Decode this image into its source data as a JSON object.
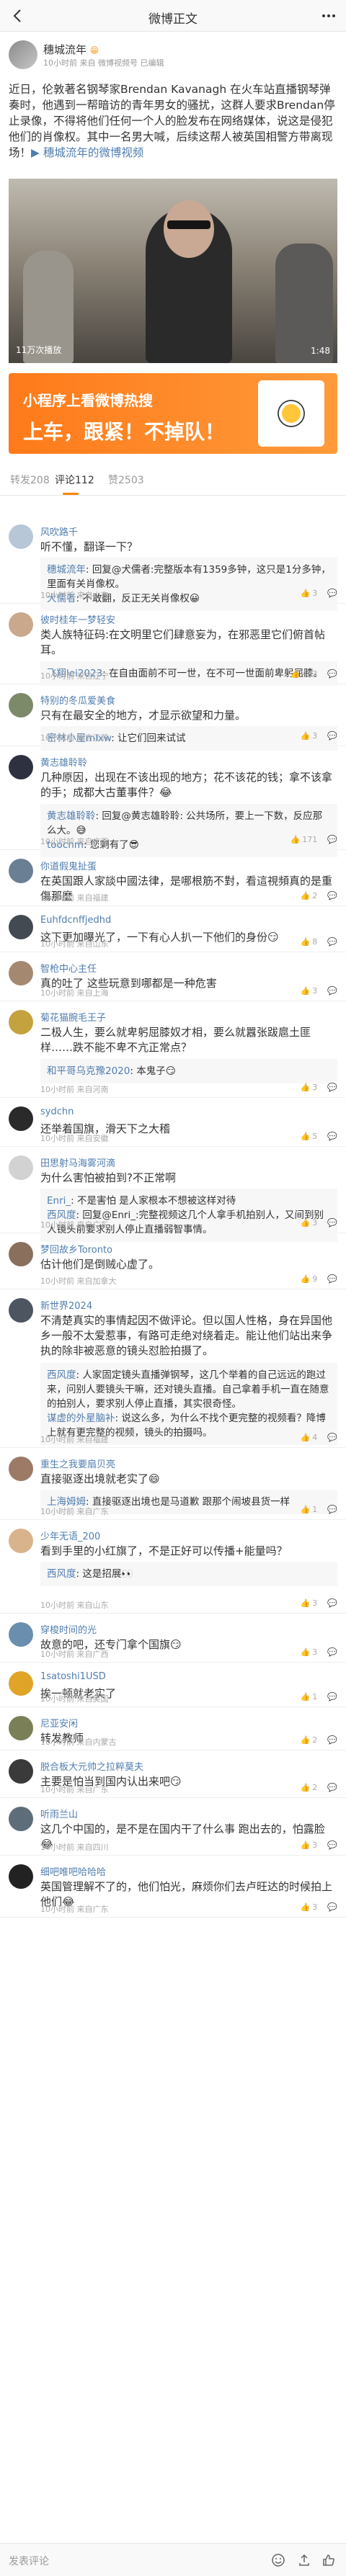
{
  "header": {
    "title": "微博正文"
  },
  "post": {
    "author": "穗城流年",
    "badge": "😁",
    "meta": "10小时前 来自 微博视频号 已编辑",
    "text": "近日，伦敦著名钢琴家Brendan Kavanagh 在火车站直播钢琴弹奏时，他遇到一帮暗访的青年男女的骚扰，这群人要求Brendan停止录像，不得将他们任何一个人的脸发布在网络媒体，说这是侵犯他们的肖像权。其中一名男大喊，后续这帮人被英国相警方带离现场！",
    "link_text": "穗城流年的微博视频",
    "video_count": "11万次播放",
    "video_duration": "1:48"
  },
  "ad": {
    "line1": "小程序上看微博热搜",
    "line2": "上车，跟紧！不掉队！"
  },
  "tabs": {
    "repost": "转发208",
    "comments": "评论112",
    "likes": "赞2503"
  },
  "comments": [
    {
      "name": "风吹路千",
      "text": "听不懂，翻译一下？",
      "replies": [
        {
          "name": "穗城流年",
          "text": "回复@犬儒者:完整版本有1359多钟，这只是1分多钟，里面有关肖像权。"
        },
        {
          "name": "犬儒者",
          "text": "不敢翻，反正无关肖像权😀"
        }
      ],
      "more": "",
      "meta": "10小时前 来自山东",
      "likes": "3",
      "avatar_color": "#b7c7d8"
    },
    {
      "name": "彼时桂年一梦轻安",
      "text": "类人族特征码:在文明里它们肆意妄为，在邪恶里它们俯首帖耳。",
      "replies": [
        {
          "name": "飞翔lei2023",
          "text": "在自由面前不可一世，在不可一世面前卑躬屈膝。"
        }
      ],
      "more": "",
      "meta": "10小时前 来自辽宁",
      "likes": "433",
      "avatar_color": "#caa88c"
    },
    {
      "name": "特别的冬瓜爱美食",
      "text": "只有在最安全的地方，才显示欲望和力量。",
      "replies": [
        {
          "name": "密林小屋mlxw",
          "text": "让它们回来试试"
        }
      ],
      "more": "",
      "meta": "10小时前 来自江苏",
      "likes": "3",
      "avatar_color": "#7c8a6a"
    },
    {
      "name": "黄志雄聆聆",
      "text": "几种原因，出现在不该出现的地方；花不该花的钱；拿不该拿的手；成都大古董事件？😂",
      "replies": [
        {
          "name": "黄志雄聆聆",
          "text": "回复@黄志雄聆聆: 公共场所，要上一下数，反应那么大。😅"
        },
        {
          "name": "toocnm",
          "text": "您剩有了😎"
        }
      ],
      "more": "",
      "meta": "10小时前 来自广西",
      "likes": "171",
      "avatar_color": "#2e3140"
    },
    {
      "name": "你道假鬼扯蛋",
      "text": "在英国跟人家談中國法律，是哪根筋不對，看這視頻真的是重傷那麼",
      "replies": [],
      "more": "",
      "meta": "10小时前 来自福建",
      "likes": "2",
      "avatar_color": "#6b7f94"
    },
    {
      "name": "Euhfdcnffjedhd",
      "text": "这下更加曝光了，一下有心人扒一下他们的身份😏",
      "replies": [],
      "more": "",
      "meta": "10小时前 来自山东",
      "likes": "8",
      "avatar_color": "#444a52"
    },
    {
      "name": "智枪中心主任",
      "text": "真的吐了 这些玩意到哪都是一种危害",
      "replies": [],
      "more": "",
      "meta": "10小时前 来自上海",
      "likes": "3",
      "avatar_color": "#a58870"
    },
    {
      "name": "菊花猫腕毛王子",
      "text": "二极人生，要么就卑躬屈膝奴才相，要么就囂张跋扈土匪样……跌不能不卑不亢正常点？",
      "replies": [
        {
          "name": "和平哥乌克豫2020",
          "text": "本鬼子😏"
        }
      ],
      "more": "",
      "meta": "10小时前 来自河南",
      "likes": "3",
      "avatar_color": "#c4a23e"
    },
    {
      "name": "sydchn",
      "text": "还举着国旗，滑天下之大稽",
      "replies": [],
      "more": "",
      "meta": "10小时前 来自安徽",
      "likes": "5",
      "avatar_color": "#2a2a2a"
    },
    {
      "name": "田思射马海雾河滴",
      "text": "为什么害怕被拍到?不正常啊",
      "replies": [
        {
          "name": "Enri_",
          "text": "不是害怕 是人家根本不想被这样对待"
        },
        {
          "name": "西风度",
          "text": "回复@Enri_:完整视频这几个人拿手机拍别人，又间到别人镜头前要求别人停止直播弱智事情。"
        }
      ],
      "more": "",
      "meta": "10小时前 来自广东",
      "likes": "3",
      "avatar_color": "#d2d2d2"
    },
    {
      "name": "梦回故乡Toronto",
      "text": "估计他们是倒贼心虚了。",
      "replies": [],
      "more": "",
      "meta": "10小时前 来自加拿大",
      "likes": "9",
      "avatar_color": "#8a6f5c"
    },
    {
      "name": "新世界2024",
      "text": "不清楚真实的事情起因不做评论。但以国人性格，身在异国他乡一般不太爱惹事，有路可走绝对绕着走。能让他们站出来争执的除非被恶意的镜头怼脸拍摄了。",
      "replies": [
        {
          "name": "西风度",
          "text": "人家固定镜头直播弹钢琴，这几个举着的自己远远的跑过来，问别人要镜头干嘛，还对镜头直播。自己拿着手机一直在随意的拍别人，要求别人停止直播，其实很奇怪。"
        },
        {
          "name": "谋虚的外星脑补",
          "text": "说这么多，为什么不找个更完整的视频看？降博上就有更完整的视频，镜头的拍摄吗。"
        }
      ],
      "more": "",
      "meta": "10小时前 来自福建",
      "likes": "4",
      "avatar_color": "#4d5560"
    },
    {
      "name": "重生之我要扇贝亮",
      "text": "直接驱逐出境就老实了😄",
      "replies": [
        {
          "name": "上海姆姆",
          "text": "直接驱逐出境也是马道歉 跟那个闹坡县货一样"
        }
      ],
      "more": "",
      "meta": "10小时前 来自广东",
      "likes": "1",
      "avatar_color": "#9c7a66"
    },
    {
      "name": "少年无语_200",
      "text": "看到手里的小红旗了，不是正好可以传播+能量吗？",
      "replies": [
        {
          "name": "西风度",
          "text": "这是招展👀"
        }
      ],
      "more": "",
      "meta": "10小时前 来自山东",
      "likes": "3",
      "avatar_color": "#d9b38c"
    },
    {
      "name": "穿梭时间的光",
      "text": "故意的吧，还专门拿个国旗😏",
      "replies": [],
      "more": "",
      "meta": "10小时前 来自广西",
      "likes": "3",
      "avatar_color": "#6a8fae"
    },
    {
      "name": "1satoshi1USD",
      "text": "挨一顿就老实了",
      "replies": [],
      "more": "",
      "meta": "10小时前 来自美国",
      "likes": "1",
      "avatar_color": "#e0a428"
    },
    {
      "name": "尼亚安闲",
      "text": "转发教师",
      "replies": [],
      "more": "",
      "meta": "10小时前 来自内蒙古",
      "likes": "2",
      "avatar_color": "#7b7f57"
    },
    {
      "name": "脱合板大元帅之拉粹莫夫",
      "text": "主要是怕当到国内认出来吧😏",
      "replies": [],
      "more": "",
      "meta": "10小时前 来自广东",
      "likes": "2",
      "avatar_color": "#3a3a3a"
    },
    {
      "name": "听雨兰山",
      "text": "这几个中国的，是不是在国内干了什么事 跑出去的，怕露脸😂",
      "replies": [],
      "more": "",
      "meta": "10小时前 来自四川",
      "likes": "3",
      "avatar_color": "#5d6e7a"
    },
    {
      "name": "细吧唯吧哈哈哈",
      "text": "英国管理解不了的，他们怕光，麻烦你们去卢旺达的时候拍上他们😂",
      "replies": [],
      "more": "",
      "meta": "10小时前 来自广东",
      "likes": "3",
      "avatar_color": "#222222"
    }
  ],
  "bottom": {
    "input_placeholder": "发表评论"
  }
}
